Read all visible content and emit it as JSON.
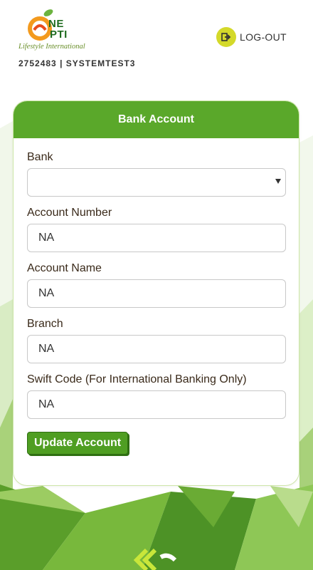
{
  "header": {
    "brand_line1": "NE",
    "brand_line2": "PTI",
    "brand_tagline": "Lifestyle International",
    "user_id": "2752483",
    "separator": "|",
    "username": "SYSTEMTEST3",
    "logout_label": "LOG-OUT",
    "logout_icon": "sign-out-icon"
  },
  "form": {
    "title": "Bank Account",
    "fields": [
      {
        "label": "Bank",
        "value": "",
        "type": "select"
      },
      {
        "label": "Account Number",
        "value": "NA"
      },
      {
        "label": "Account Name",
        "value": "NA"
      },
      {
        "label": "Branch",
        "value": "NA"
      },
      {
        "label": "Swift Code (For International Banking Only)",
        "value": "NA"
      }
    ],
    "submit_label": "Update Account"
  },
  "colors": {
    "brand_green": "#5aa82a",
    "button_green": "#4f9e22",
    "logout_badge": "#d4d92a"
  }
}
